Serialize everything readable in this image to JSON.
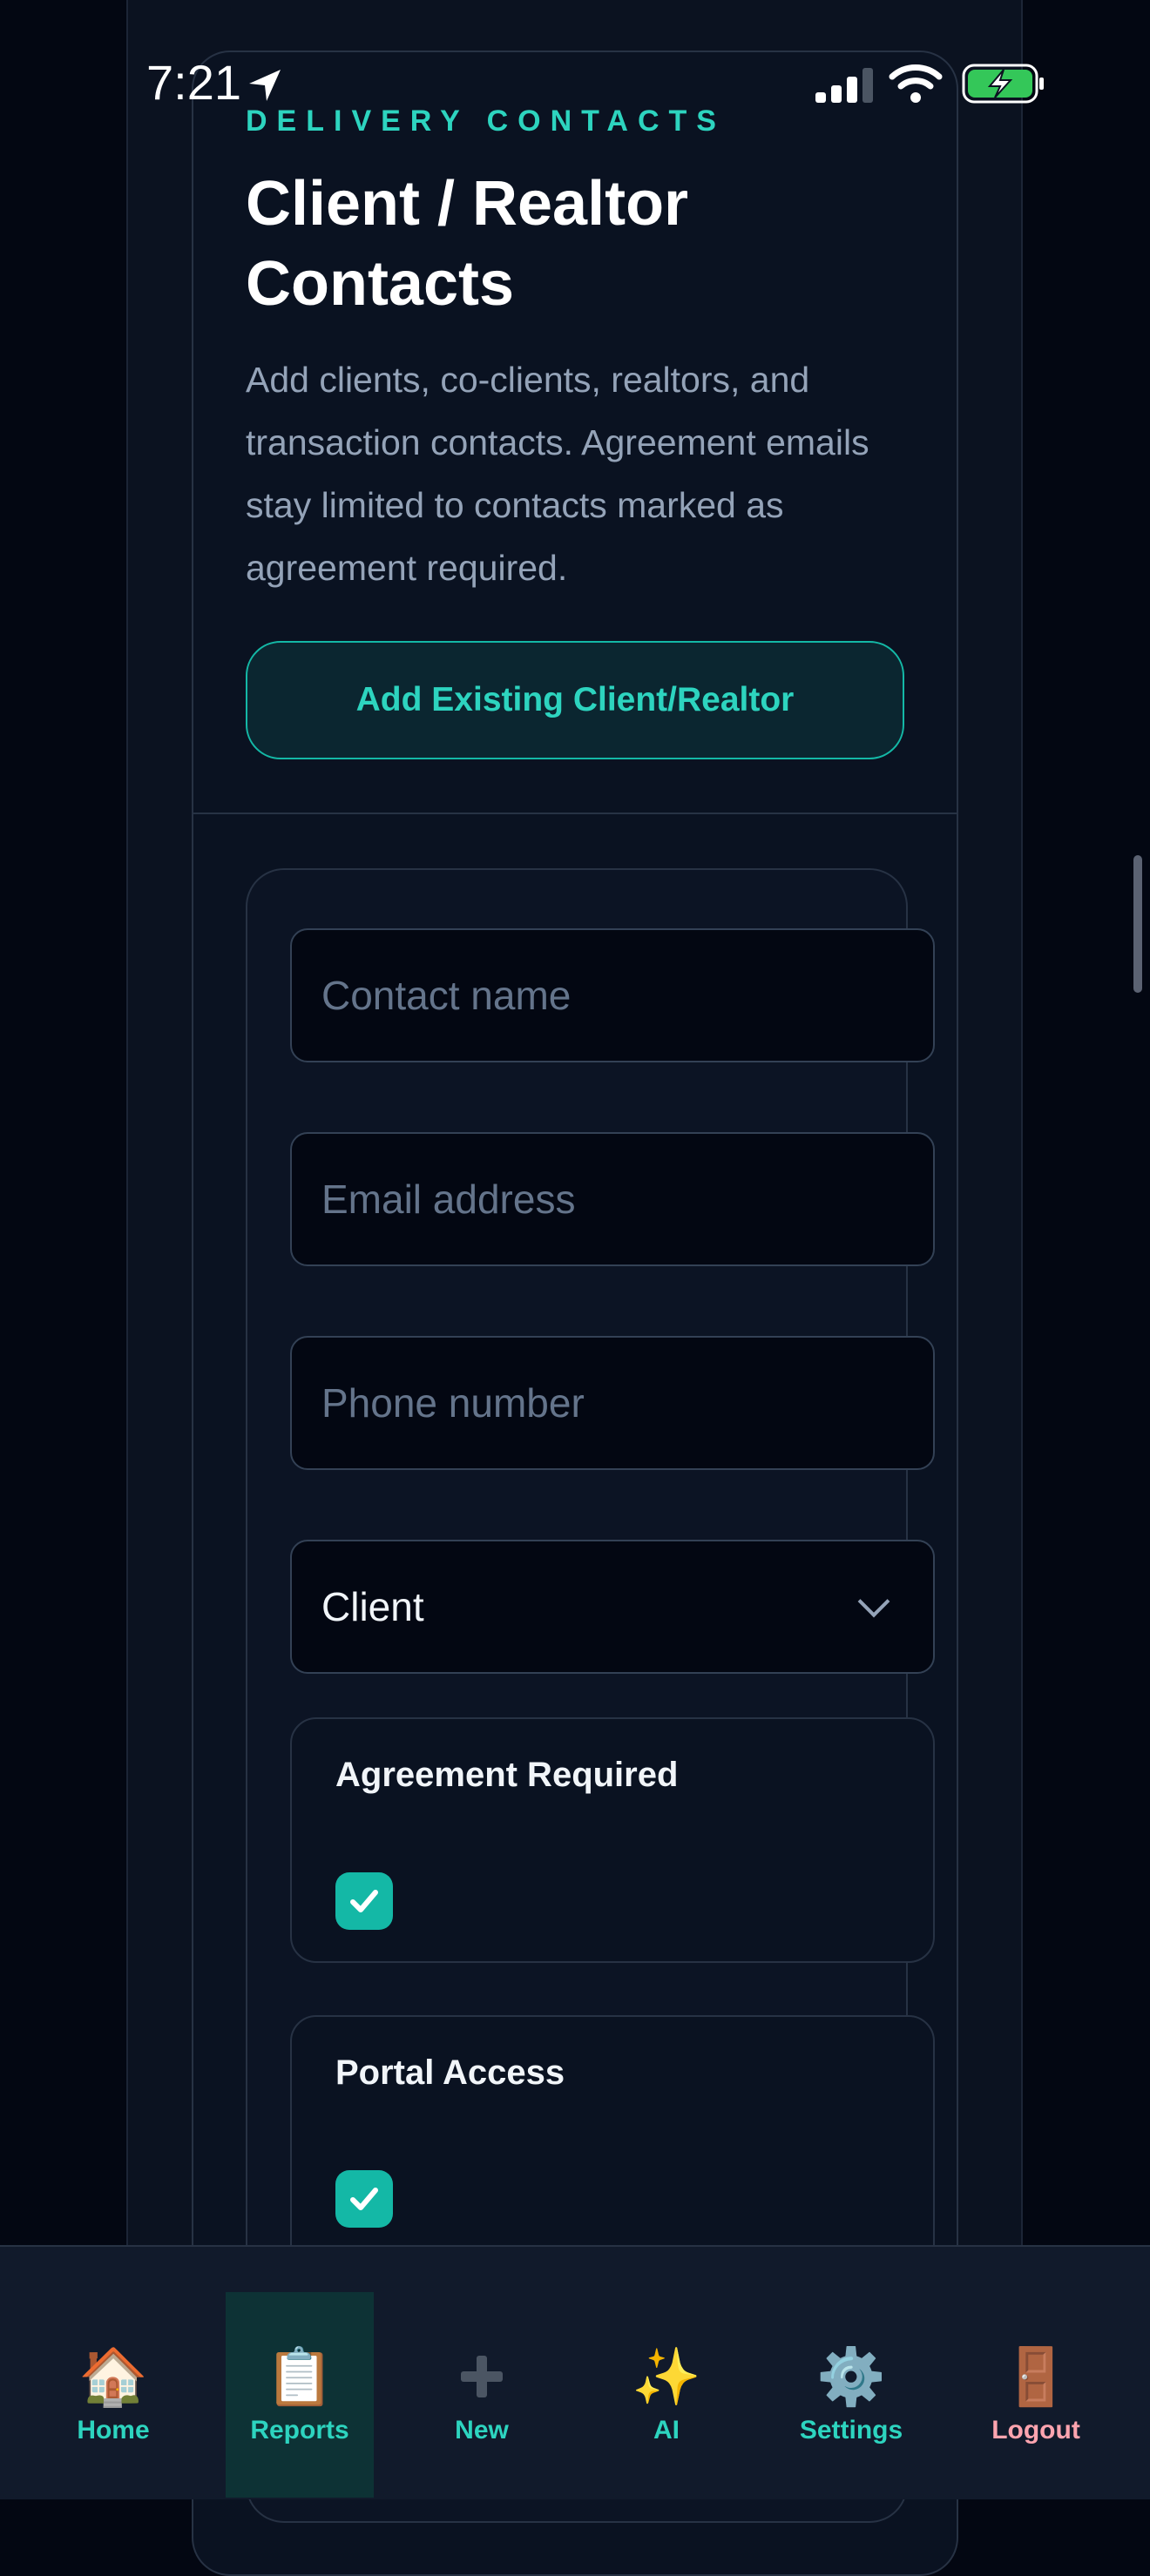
{
  "status_bar": {
    "time": "7:21"
  },
  "section": {
    "eyebrow": "DELIVERY CONTACTS",
    "title": "Client / Realtor Contacts",
    "description": "Add clients, co-clients, realtors, and transaction contacts. Agreement emails stay limited to contacts marked as agreement required.",
    "add_existing_label": "Add Existing Client/Realtor"
  },
  "contact_form": {
    "name_placeholder": "Contact name",
    "email_placeholder": "Email address",
    "phone_placeholder": "Phone number",
    "role_selected": "Client",
    "agreement_required": {
      "label": "Agreement Required",
      "checked": true
    },
    "portal_access": {
      "label": "Portal Access",
      "checked": true
    }
  },
  "colors": {
    "accent": "#2dd4bf",
    "background": "#030712",
    "logout": "#fda4af"
  },
  "tabbar": {
    "items": [
      {
        "label": "Home",
        "icon": "house-icon",
        "emoji": "🏠"
      },
      {
        "label": "Reports",
        "icon": "clipboard-icon",
        "emoji": "📋",
        "active": true
      },
      {
        "label": "New",
        "icon": "plus-icon",
        "emoji": "➕"
      },
      {
        "label": "AI",
        "icon": "sparkles-icon",
        "emoji": "✨"
      },
      {
        "label": "Settings",
        "icon": "gear-icon",
        "emoji": "⚙️"
      },
      {
        "label": "Logout",
        "icon": "door-icon",
        "emoji": "🚪"
      }
    ]
  }
}
